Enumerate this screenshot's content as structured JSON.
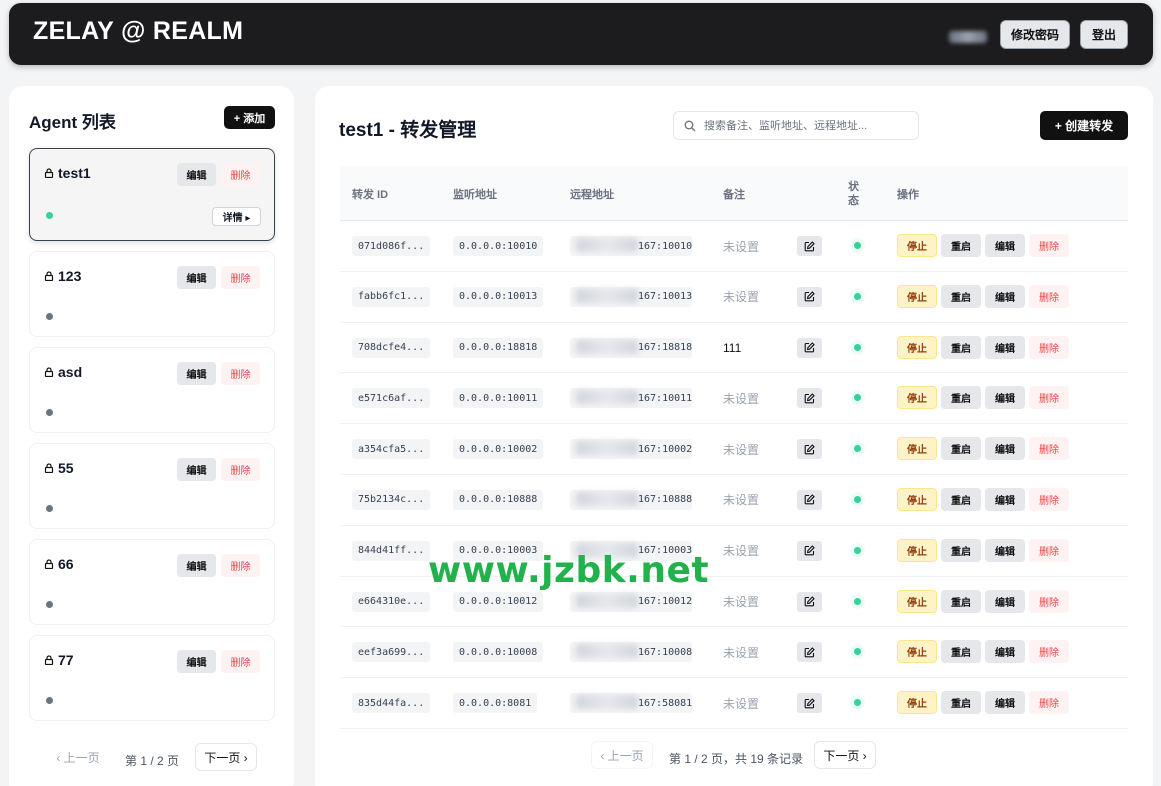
{
  "header": {
    "brand": "ZELAY @ REALM",
    "change_password": "修改密码",
    "logout": "登出"
  },
  "agents": {
    "title": "Agent 列表",
    "add_label": "+ 添加",
    "edit_label": "编辑",
    "delete_label": "删除",
    "detail_label": "详情 ▸",
    "items": [
      {
        "name": "test1",
        "online": true
      },
      {
        "name": "123",
        "online": false
      },
      {
        "name": "asd",
        "online": false
      },
      {
        "name": "55",
        "online": false
      },
      {
        "name": "66",
        "online": false
      },
      {
        "name": "77",
        "online": false
      }
    ],
    "pager": {
      "prev": "‹ 上一页",
      "info": "第 1 / 2 页",
      "next": "下一页 ›"
    }
  },
  "forwards": {
    "title": "test1 - 转发管理",
    "search_placeholder": "搜索备注、监听地址、远程地址...",
    "create_label": "+ 创建转发",
    "columns": {
      "id": "转发 ID",
      "listen": "监听地址",
      "remote": "远程地址",
      "note": "备注",
      "status": "状\n态",
      "actions": "操作"
    },
    "actions": {
      "stop": "停止",
      "restart": "重启",
      "edit": "编辑",
      "delete": "删除"
    },
    "rows": [
      {
        "id": "071d086f...",
        "listen": "0.0.0.0:10010",
        "remote_port": "167:10010",
        "note": "未设置",
        "note_set": false
      },
      {
        "id": "fabb6fc1...",
        "listen": "0.0.0.0:10013",
        "remote_port": "167:10013",
        "note": "未设置",
        "note_set": false
      },
      {
        "id": "708dcfe4...",
        "listen": "0.0.0.0:18818",
        "remote_port": "167:18818",
        "note": "111",
        "note_set": true
      },
      {
        "id": "e571c6af...",
        "listen": "0.0.0.0:10011",
        "remote_port": "167:10011",
        "note": "未设置",
        "note_set": false
      },
      {
        "id": "a354cfa5...",
        "listen": "0.0.0.0:10002",
        "remote_port": "167:10002",
        "note": "未设置",
        "note_set": false
      },
      {
        "id": "75b2134c...",
        "listen": "0.0.0.0:10888",
        "remote_port": "167:10888",
        "note": "未设置",
        "note_set": false
      },
      {
        "id": "844d41ff...",
        "listen": "0.0.0.0:10003",
        "remote_port": "167:10003",
        "note": "未设置",
        "note_set": false
      },
      {
        "id": "e664310e...",
        "listen": "0.0.0.0:10012",
        "remote_port": "167:10012",
        "note": "未设置",
        "note_set": false
      },
      {
        "id": "eef3a699...",
        "listen": "0.0.0.0:10008",
        "remote_port": "167:10008",
        "note": "未设置",
        "note_set": false
      },
      {
        "id": "835d44fa...",
        "listen": "0.0.0.0:8081",
        "remote_port": "167:58081",
        "note": "未设置",
        "note_set": false
      }
    ],
    "pager": {
      "prev": "‹ 上一页",
      "info": "第 1 / 2 页，共 19 条记录",
      "next": "下一页 ›"
    }
  },
  "watermark": "www.jzbk.net",
  "colors": {
    "online": "#34d399",
    "offline": "#6b7280",
    "danger": "#ef4444",
    "warning_bg": "#fef3c7"
  }
}
